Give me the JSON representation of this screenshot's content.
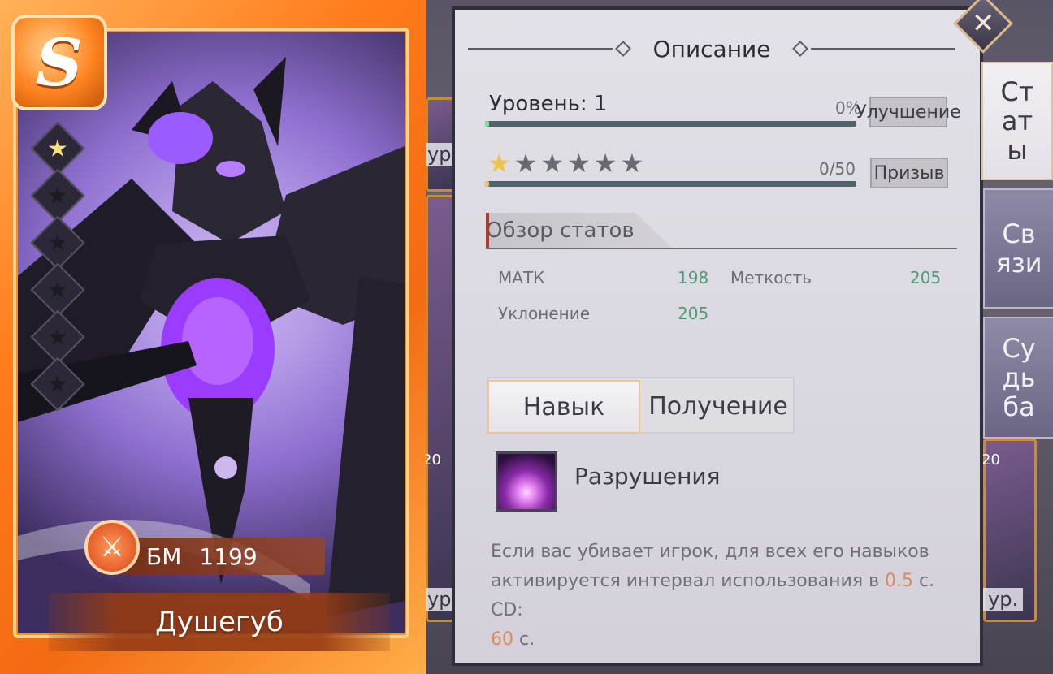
{
  "hero": {
    "rarity": "S",
    "stars_total": 6,
    "stars_filled": 1,
    "bm_label": "БМ",
    "bm_value": "1199",
    "name": "Душегуб"
  },
  "panel": {
    "title": "Описание",
    "level_label": "Уровень: 1",
    "level_percent": "0%",
    "level_progress": 0.01,
    "upgrade_button": "Улучшение",
    "stars_filled": 1,
    "stars_total": 6,
    "shards": "0/50",
    "shards_progress": 0.01,
    "summon_button": "Призыв",
    "stats_section_title": "Обзор статов",
    "stats": [
      {
        "name": "МАТК",
        "value": "198"
      },
      {
        "name": "Меткость",
        "value": "205"
      },
      {
        "name": "Уклонение",
        "value": "205"
      }
    ],
    "skill_tabs": {
      "skill": "Навык",
      "obtain": "Получение"
    },
    "skill": {
      "name": "Разрушения",
      "desc_part1": "Если вас убивает игрок, для всех его навыков активируется интервал использования в ",
      "desc_hl1": "0.5",
      "desc_part2": " с. CD: ",
      "desc_hl2": "60",
      "desc_part3": " с."
    }
  },
  "side_tabs": [
    {
      "label": "Статы",
      "active": true
    },
    {
      "label": "Связи",
      "active": false
    },
    {
      "label": "Судьба",
      "active": false
    }
  ],
  "background": {
    "level_labels": [
      "ур",
      "ур",
      "ур."
    ],
    "numbers": [
      "20",
      "20"
    ]
  },
  "colors": {
    "card_orange": "#ff7a1a",
    "stat_value_green": "#4f9b74",
    "highlight_orange": "#d98a5e",
    "progress_green": "#7ee0a2"
  },
  "icons": {
    "close": "close-x-icon",
    "battle_power": "crossed-swords-icon",
    "star": "star-icon",
    "skill": "purple-burst-skill-icon"
  }
}
